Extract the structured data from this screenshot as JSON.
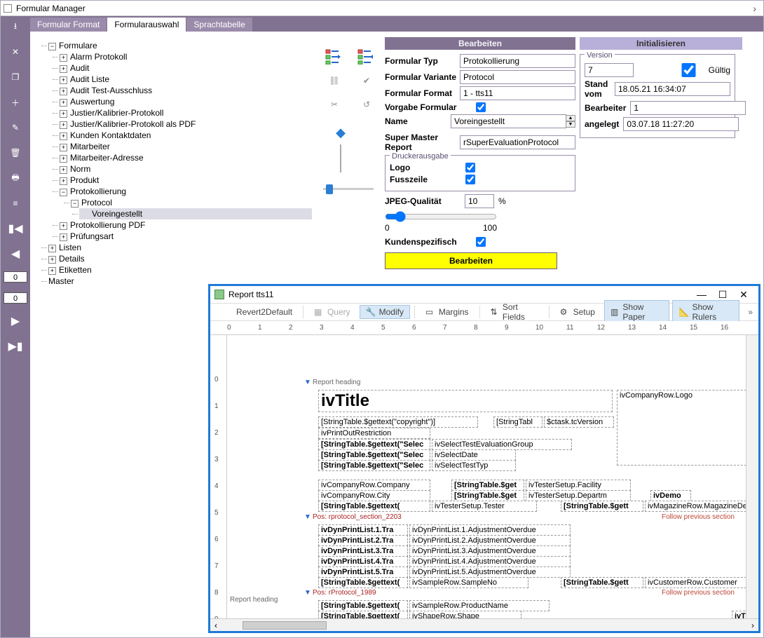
{
  "window": {
    "title": "Formular Manager"
  },
  "tabs": [
    "Formular Format",
    "Formularauswahl",
    "Sprachtabelle"
  ],
  "activeTab": 1,
  "leftToolbar": {
    "num1": "0",
    "num2": "0"
  },
  "tree": {
    "root": "Formulare",
    "children": [
      "Alarm Protokoll",
      "Audit",
      "Audit Liste",
      "Audit Test-Ausschluss",
      "Auswertung",
      "Justier/Kalibrier-Protokoll",
      "Justier/Kalibrier-Protokoll als PDF",
      "Kunden Kontaktdaten",
      "Mitarbeiter",
      "Mitarbeiter-Adresse",
      "Norm",
      "Produkt"
    ],
    "protokollierung": {
      "label": "Protokollierung",
      "protocol": {
        "label": "Protocol",
        "child": "Voreingestellt"
      },
      "pdf": "Protokollierung PDF",
      "pruef": "Prüfungsart"
    },
    "tail": [
      "Listen",
      "Details",
      "Etiketten",
      "Master"
    ]
  },
  "headers": {
    "edit": "Bearbeiten",
    "init": "Initialisieren"
  },
  "form": {
    "typ_l": "Formular Typ",
    "typ_v": "Protokollierung",
    "var_l": "Formular Variante",
    "var_v": "Protocol",
    "fmt_l": "Formular Format",
    "fmt_v": "1 - tts11",
    "vorgabe_l": "Vorgabe Formular",
    "name_l": "Name",
    "name_v": "Voreingestellt",
    "smr_l": "Super Master Report",
    "smr_v": "rSuperEvaluationProtocol",
    "drucker_legend": "Druckerausgabe",
    "logo_l": "Logo",
    "fuss_l": "Fusszeile",
    "jpeg_l": "JPEG-Qualität",
    "jpeg_v": "10",
    "pct": "%",
    "scale_min": "0",
    "scale_max": "100",
    "kund_l": "Kundenspezifisch",
    "edit_btn": "Bearbeiten"
  },
  "version": {
    "legend": "Version",
    "num": "7",
    "gueltig": "Gültig",
    "stand_l": "Stand vom",
    "stand_v": "18.05.21 16:34:07",
    "bearb_l": "Bearbeiter",
    "bearb_v": "1",
    "ang_l": "angelegt",
    "ang_v": "03.07.18 11:27:20"
  },
  "report": {
    "title": "Report tts11",
    "toolbar": {
      "revert": "Revert2Default",
      "query": "Query",
      "modify": "Modify",
      "margins": "Margins",
      "sort": "Sort Fields",
      "setup": "Setup",
      "paper": "Show Paper",
      "rulers": "Show Rulers"
    },
    "sections": {
      "heading": "Report heading",
      "pos1": "Pos: rprotocol_section_2203",
      "pos2": "Pos: rProtocol_1989",
      "follow": "Follow previous section"
    },
    "fields": {
      "ivTitle": "ivTitle",
      "copyright": "[StringTable.$gettext(\"copyright\")]",
      "stringtabl": "[StringTabl",
      "sctask": "$ctask.tcVersion",
      "printout": "ivPrintOutRestriction",
      "selec1": "[StringTable.$gettext(\"Selec",
      "selgrp": "ivSelectTestEvaluationGroup",
      "selec2": "[StringTable.$gettext(\"Selec",
      "seldate": "ivSelectDate",
      "selec3": "[StringTable.$gettext(\"Selec",
      "seltyp": "ivSelectTestTyp",
      "comp": "ivCompanyRow.Company",
      "sget1": "[StringTable.$get",
      "fac": "ivTesterSetup.Facility",
      "city": "ivCompanyRow.City",
      "sget2": "[StringTable.$get",
      "dep": "ivTesterSetup.Departm",
      "sgettext": "[StringTable.$gettext(",
      "tester": "ivTesterSetup.Tester",
      "sgett": "[StringTable.$gett",
      "demo": "ivDemo",
      "mag": "ivMagazineRow.MagazineDe",
      "logo": "ivCompanyRow.Logo",
      "dyn1t": "ivDynPrintList.1.Tra",
      "dyn1a": "ivDynPrintList.1.AdjustmentOverdue",
      "dyn2t": "ivDynPrintList.2.Tra",
      "dyn2a": "ivDynPrintList.2.AdjustmentOverdue",
      "dyn3t": "ivDynPrintList.3.Tra",
      "dyn3a": "ivDynPrintList.3.AdjustmentOverdue",
      "dyn4t": "ivDynPrintList.4.Tra",
      "dyn4a": "ivDynPrintList.4.AdjustmentOverdue",
      "dyn5t": "ivDynPrintList.5.Tra",
      "dyn5a": "ivDynPrintList.5.AdjustmentOverdue",
      "sgettext2": "[StringTable.$gettext(",
      "samp": "ivSampleRow.SampleNo",
      "sgett2": "[StringTable.$gett",
      "cust": "ivCustomerRow.Customer",
      "sgettext3": "[StringTable.$gettext(",
      "prod": "ivSampleRow.ProductName",
      "sgettext4": "[StringTable.$gettext(",
      "shape": "ivShapeRow.Shape",
      "ivt": "ivT"
    }
  }
}
